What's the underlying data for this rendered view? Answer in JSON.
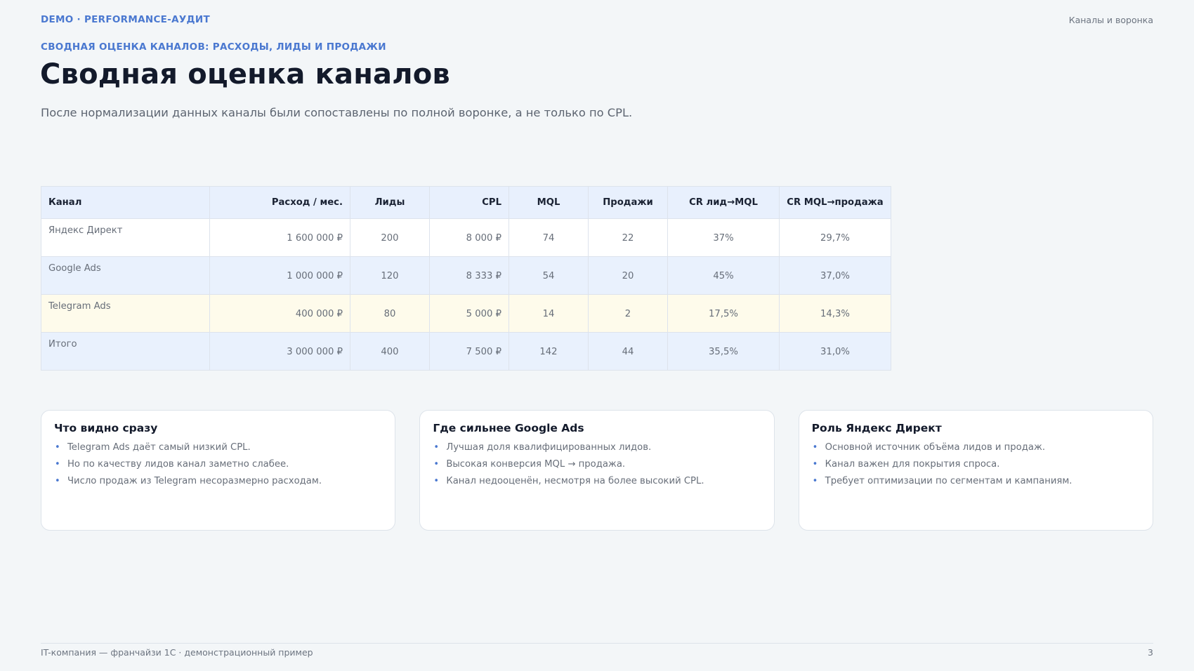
{
  "header": {
    "brand": "DEMO · PERFORMANCE-АУДИТ",
    "section": "Каналы и воронка"
  },
  "eyebrow": "СВОДНАЯ ОЦЕНКА КАНАЛОВ: РАСХОДЫ, ЛИДЫ И ПРОДАЖИ",
  "title": "Сводная оценка каналов",
  "lead": "После нормализации данных каналы были сопоставлены по полной воронке, а не только по CPL.",
  "table": {
    "columns": [
      "Канал",
      "Расход / мес.",
      "Лиды",
      "CPL",
      "MQL",
      "Продажи",
      "CR лид→MQL",
      "CR MQL→продажа"
    ],
    "rows": [
      [
        "Яндекс Директ",
        "1 600 000 ₽",
        "200",
        "8 000 ₽",
        "74",
        "22",
        "37%",
        "29,7%"
      ],
      [
        "Google Ads",
        "1 000 000 ₽",
        "120",
        "8 333 ₽",
        "54",
        "20",
        "45%",
        "37,0%"
      ],
      [
        "Telegram Ads",
        "400 000 ₽",
        "80",
        "5 000 ₽",
        "14",
        "2",
        "17,5%",
        "14,3%"
      ],
      [
        "Итого",
        "3 000 000 ₽",
        "400",
        "7 500 ₽",
        "142",
        "44",
        "35,5%",
        "31,0%"
      ]
    ]
  },
  "cards": [
    {
      "title": "Что видно сразу",
      "items": [
        "Telegram Ads даёт самый низкий CPL.",
        "Но по качеству лидов канал заметно слабее.",
        "Число продаж из Telegram несоразмерно расходам."
      ]
    },
    {
      "title": "Где сильнее Google Ads",
      "items": [
        "Лучшая доля квалифицированных лидов.",
        "Высокая конверсия MQL → продажа.",
        "Канал недооценён, несмотря на более высокий CPL."
      ]
    },
    {
      "title": "Роль Яндекс Директ",
      "items": [
        "Основной источник объёма лидов и продаж.",
        "Канал важен для покрытия спроса.",
        "Требует оптимизации по сегментам и кампаниям."
      ]
    }
  ],
  "bullet": "•",
  "footer": {
    "left": "IT-компания — франчайзи 1С · демонстрационный пример",
    "page": "3"
  },
  "colors": {
    "accent": "#4a78d0",
    "background": "#f3f6f8",
    "header_row": "#e8f0fd",
    "highlight_row": "#fefbeb"
  }
}
